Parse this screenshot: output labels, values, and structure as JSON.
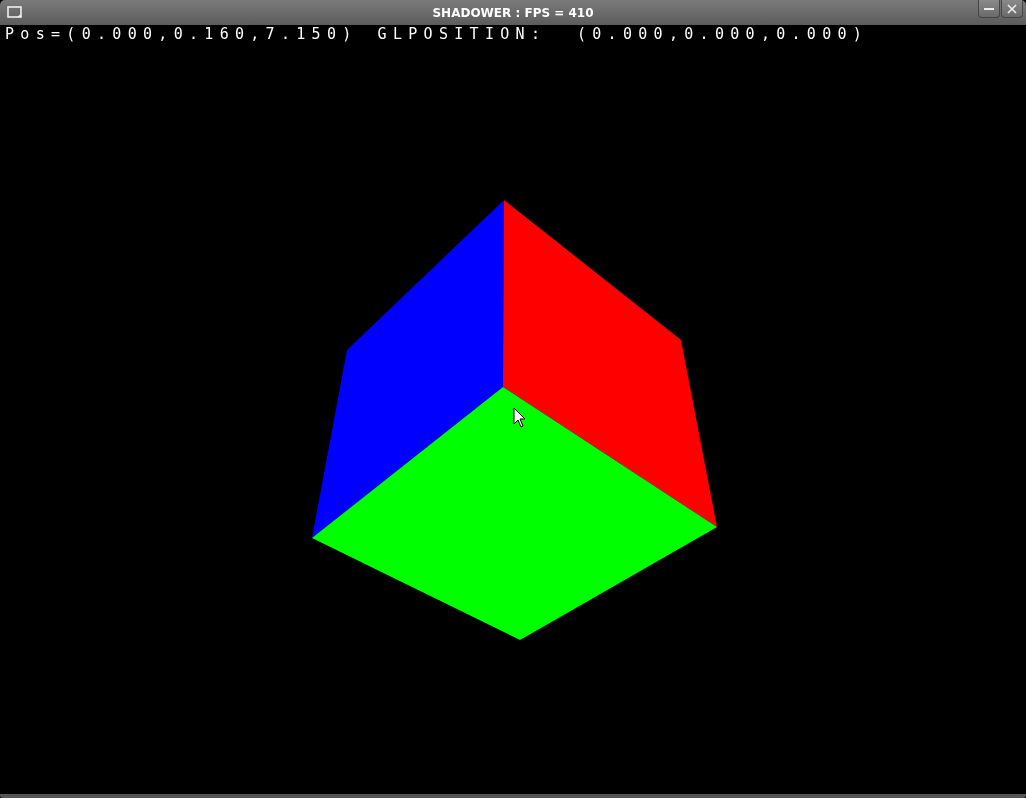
{
  "window": {
    "title": "SHADOWER : FPS = 410"
  },
  "overlay": {
    "readouts": [
      "Pos=(0.000,0.160,7.150)",
      "GLPOSITION:  (0.000,0.000,0.000)"
    ]
  }
}
